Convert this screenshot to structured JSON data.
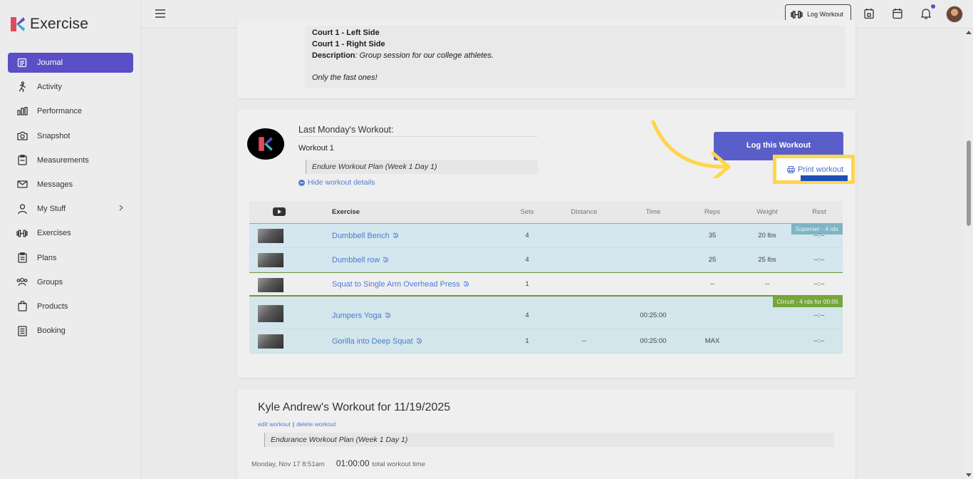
{
  "app": {
    "name": "Exercise",
    "brand_colors": {
      "primary": "#5a4fc6",
      "link": "#4e7cd0",
      "highlight": "#ffd54a"
    }
  },
  "sidebar": {
    "items": [
      {
        "label": "Journal",
        "icon": "journal-icon",
        "active": true
      },
      {
        "label": "Activity",
        "icon": "running-icon",
        "active": false
      },
      {
        "label": "Performance",
        "icon": "bar-chart-icon",
        "active": false
      },
      {
        "label": "Snapshot",
        "icon": "camera-icon",
        "active": false
      },
      {
        "label": "Measurements",
        "icon": "clipboard-icon",
        "active": false
      },
      {
        "label": "Messages",
        "icon": "mail-icon",
        "active": false
      },
      {
        "label": "My Stuff",
        "icon": "user-icon",
        "active": false,
        "has_submenu": true
      },
      {
        "label": "Exercises",
        "icon": "dumbbell-icon",
        "active": false
      },
      {
        "label": "Plans",
        "icon": "clipboard-list-icon",
        "active": false
      },
      {
        "label": "Groups",
        "icon": "users-icon",
        "active": false
      },
      {
        "label": "Products",
        "icon": "shopping-bag-icon",
        "active": false
      },
      {
        "label": "Booking",
        "icon": "booking-icon",
        "active": false
      }
    ]
  },
  "topbar": {
    "log_workout_label": "Log Workout"
  },
  "previous_card": {
    "line1": "Court 1 - Left Side",
    "line2": "Court 1 - Right Side",
    "description_label": "Description",
    "description_text": ": Group session for our college athletes.",
    "note": "Only the fast ones!"
  },
  "last_workout": {
    "heading": "Last Monday's Workout:",
    "workout_name": "Workout 1",
    "plan_name": "Endure Workout Plan (Week 1 Day 1)",
    "hide_details_label": "Hide workout details",
    "log_this_label": "Log this Workout",
    "print_label": "Print workout",
    "table": {
      "headers": {
        "video": "",
        "exercise": "Exercise",
        "sets": "Sets",
        "distance": "Distance",
        "time": "Time",
        "reps": "Reps",
        "weight": "Weight",
        "rest": "Rest"
      },
      "superset_tag": "Superset - 4 rds",
      "circuit_tag": "Circuit - 4 rds for 00:05",
      "rows": [
        {
          "exercise": "Dumbbell Bench",
          "sets": "4",
          "distance": "",
          "time": "",
          "reps": "35",
          "weight": "20 lbs",
          "rest": "--:--"
        },
        {
          "exercise": "Dumbbell row",
          "sets": "4",
          "distance": "",
          "time": "",
          "reps": "25",
          "weight": "25 lbs",
          "rest": "--:--"
        },
        {
          "exercise": "Squat to Single Arm Overhead Press",
          "sets": "1",
          "distance": "",
          "time": "",
          "reps": "--",
          "weight": "--",
          "rest": "--:--"
        },
        {
          "exercise": "Jumpers Yoga",
          "sets": "4",
          "distance": "",
          "time": "00:25:00",
          "reps": "",
          "weight": "",
          "rest": "--:--"
        },
        {
          "exercise": "Gorilla into Deep Squat",
          "sets": "1",
          "distance": "--",
          "time": "00:25:00",
          "reps": "MAX",
          "weight": "",
          "rest": "--:--"
        }
      ]
    }
  },
  "kyle_workout": {
    "title": "Kyle Andrew's Workout for 11/19/2025",
    "edit_label": "edit workout",
    "separator": "|",
    "delete_label": "delete workout",
    "plan_name": "Endurance Workout Plan (Week 1 Day 1)",
    "date_text": "Monday, Nov 17 8:51am",
    "duration": "01:00:00",
    "duration_suffix": "total workout time"
  }
}
